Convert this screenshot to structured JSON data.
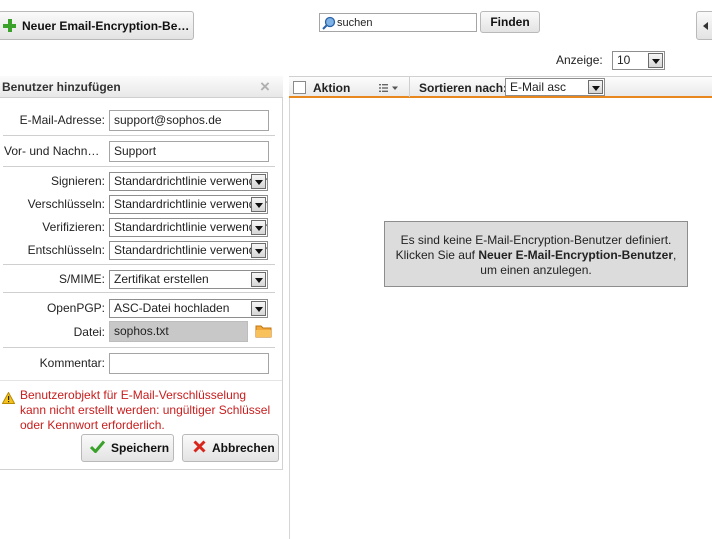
{
  "toolbar": {
    "new_button_label": "Neuer Email-Encryption-Be…",
    "search_value": "suchen",
    "find_button_label": "Finden",
    "display_label": "Anzeige:",
    "display_value": "10"
  },
  "panel": {
    "title": "Benutzer hinzufügen",
    "email_label": "E-Mail-Adresse:",
    "email_value": "support@sophos.de",
    "name_label": "Vor- und Nachn…",
    "name_value": "Support",
    "sign_label": "Signieren:",
    "sign_value": "Standardrichtlinie verwenden",
    "encrypt_label": "Verschlüsseln:",
    "encrypt_value": "Standardrichtlinie verwenden",
    "verify_label": "Verifizieren:",
    "verify_value": "Standardrichtlinie verwenden",
    "decrypt_label": "Entschlüsseln:",
    "decrypt_value": "Standardrichtlinie verwenden",
    "smime_label": "S/MIME:",
    "smime_value": "Zertifikat erstellen",
    "openpgp_label": "OpenPGP:",
    "openpgp_value": "ASC-Datei hochladen",
    "file_label": "Datei:",
    "file_value": "sophos.txt",
    "comment_label": "Kommentar:",
    "comment_value": "",
    "error_line1": "Benutzerobjekt für E-Mail-Verschlüsselung",
    "error_line2": "kann nicht erstellt werden: ungültiger Schlüssel",
    "error_line3": "oder Kennwort erforderlich.",
    "save_label": "Speichern",
    "cancel_label": "Abbrechen"
  },
  "list": {
    "action_label": "Aktion",
    "sort_label": "Sortieren nach:",
    "sort_value": "E-Mail asc",
    "empty_line1": "Es sind keine E-Mail-Encryption-Benutzer definiert.",
    "empty_line2_prefix": "Klicken Sie auf ",
    "empty_line2_bold": "Neuer E-Mail-Encryption-Benutzer",
    "empty_line2_suffix": ",",
    "empty_line3": "um einen anzulegen."
  },
  "colors": {
    "accent_orange": "#e8871e",
    "error_red": "#c81e1e",
    "ok_green": "#3aa12a",
    "cancel_red": "#d9261c",
    "file_bg": "#c8c8c8"
  }
}
